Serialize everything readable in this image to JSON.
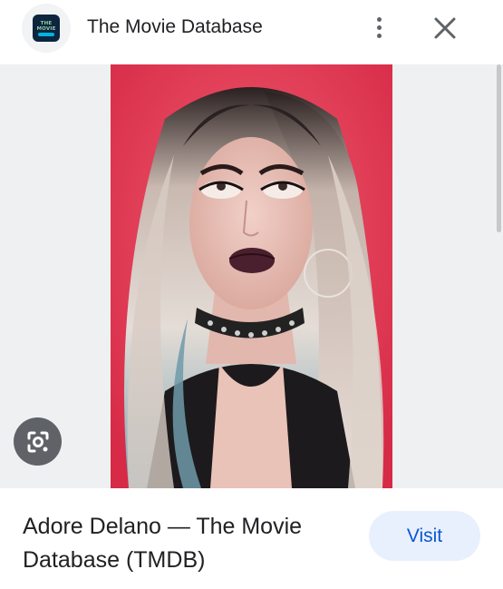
{
  "header": {
    "site_logo_text": [
      "THE",
      "MOVIE",
      "DB"
    ],
    "site_title": "The Movie Database",
    "more_icon": "more-vert-icon",
    "close_icon": "close-icon"
  },
  "image": {
    "subject": "photo",
    "lens_icon": "google-lens-icon"
  },
  "caption": {
    "title": "Adore Delano — The Movie Database (TMDB)",
    "visit_label": "Visit"
  },
  "colors": {
    "visit_bg": "#e8f0fe",
    "visit_text": "#0b57d0",
    "photo_bg": "#e0334f",
    "tmdb_navy": "#0d253f",
    "tmdb_green": "#90cea1",
    "tmdb_blue": "#01b4e4"
  }
}
